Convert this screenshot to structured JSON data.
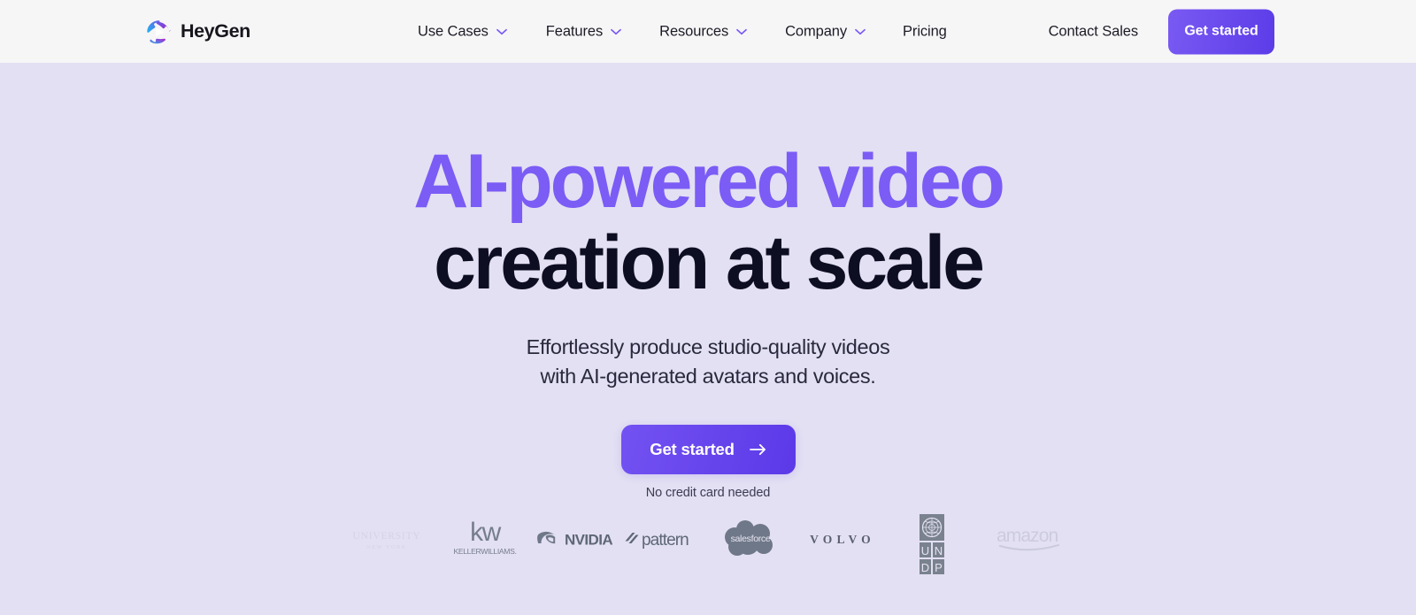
{
  "brand": {
    "name": "HeyGen",
    "logo_icon": "heygen-play-triangle-logo",
    "colors": {
      "logo_blue": "#29B6F6",
      "logo_purple": "#9C27D8"
    }
  },
  "header": {
    "background": "#F7F6F7",
    "nav": [
      {
        "label": "Use Cases",
        "has_dropdown": true,
        "icon": "chevron-down-icon"
      },
      {
        "label": "Features",
        "has_dropdown": true,
        "icon": "chevron-down-icon"
      },
      {
        "label": "Resources",
        "has_dropdown": true,
        "icon": "chevron-down-icon"
      },
      {
        "label": "Company",
        "has_dropdown": true,
        "icon": "chevron-down-icon"
      },
      {
        "label": "Pricing",
        "has_dropdown": false
      }
    ],
    "contact_sales_label": "Contact Sales",
    "get_started_label": "Get started",
    "chevron_color": "#7B5CF5",
    "cta_gradient": [
      "#7A5AF2",
      "#5B3CE8"
    ]
  },
  "hero": {
    "background": "#E3E0F3",
    "headline_line1": "AI-powered video",
    "headline_line2": "creation at scale",
    "headline_line1_color": "#7B5CF5",
    "headline_line2_color": "#0E0E22",
    "subhead_line1": "Effortlessly produce studio-quality videos",
    "subhead_line2": "with AI-generated avatars and voices.",
    "cta_label": "Get started",
    "cta_icon": "arrow-right-icon",
    "cta_note": "No credit card needed",
    "cta_gradient": [
      "#7352F2",
      "#5B39E8"
    ]
  },
  "logo_strip": {
    "color": "#737C8C",
    "logos": [
      {
        "name": "columbia-university",
        "label": "UNIVERSITY",
        "sublabel": "NEW YORK",
        "faded": true
      },
      {
        "name": "keller-williams",
        "label": "kw",
        "sublabel": "KELLERWILLIAMS.",
        "faded": false
      },
      {
        "name": "nvidia",
        "label": "NVIDIA",
        "faded": false
      },
      {
        "name": "pattern",
        "label": "pattern",
        "faded": false
      },
      {
        "name": "salesforce",
        "label": "salesforce",
        "faded": false
      },
      {
        "name": "volvo",
        "label": "VOLVO",
        "faded": false
      },
      {
        "name": "undp",
        "label": "UNDP",
        "faded": false
      },
      {
        "name": "amazon",
        "label": "amazon",
        "faded": true
      }
    ]
  }
}
